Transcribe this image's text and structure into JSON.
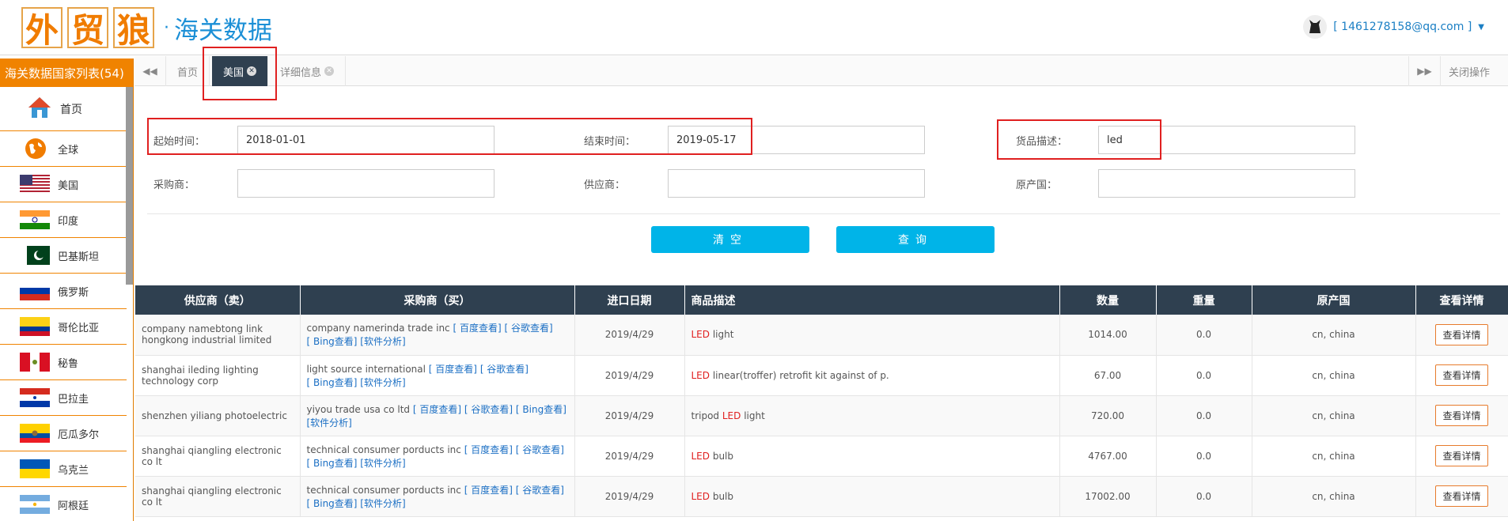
{
  "header": {
    "logo_chars": [
      "外",
      "贸",
      "狼"
    ],
    "logo_dot": "·",
    "logo_sub": "海关数据",
    "user_email": "[ 1461278158@qq.com ]"
  },
  "sidebar": {
    "title": "海关数据国家列表(54)",
    "items": [
      {
        "label": "首页",
        "icon": "home-icon"
      },
      {
        "label": "全球",
        "icon": "globe-icon"
      },
      {
        "label": "美国",
        "icon": "flag-us-icon"
      },
      {
        "label": "印度",
        "icon": "flag-india-icon"
      },
      {
        "label": "巴基斯坦",
        "icon": "flag-pakistan-icon"
      },
      {
        "label": "俄罗斯",
        "icon": "flag-russia-icon"
      },
      {
        "label": "哥伦比亚",
        "icon": "flag-colombia-icon"
      },
      {
        "label": "秘鲁",
        "icon": "flag-peru-icon"
      },
      {
        "label": "巴拉圭",
        "icon": "flag-paraguay-icon"
      },
      {
        "label": "厄瓜多尔",
        "icon": "flag-ecuador-icon"
      },
      {
        "label": "乌克兰",
        "icon": "flag-ukraine-icon"
      },
      {
        "label": "阿根廷",
        "icon": "flag-argentina-icon"
      }
    ]
  },
  "tabs": {
    "prev": "◀◀",
    "items": [
      {
        "label": "首页"
      },
      {
        "label": "美国"
      },
      {
        "label": "详细信息"
      }
    ],
    "next": "▶▶",
    "close_ops": "关闭操作"
  },
  "form": {
    "start_label": "起始时间：",
    "start_value": "2018-01-01",
    "end_label": "结束时间：",
    "end_value": "2019-05-17",
    "goods_label": "货品描述：",
    "goods_value": "led",
    "buyer_label": "采购商：",
    "buyer_value": "",
    "supplier_label": "供应商：",
    "supplier_value": "",
    "origin_label": "原产国：",
    "origin_value": "",
    "clear_button": "清空",
    "query_button": "查询"
  },
  "table": {
    "headers": [
      "供应商（卖）",
      "采购商（买）",
      "进口日期",
      "商品描述",
      "数量",
      "重量",
      "原产国",
      "查看详情"
    ],
    "link_baidu": "[ 百度查看]",
    "link_google": "[ 谷歌查看]",
    "link_bing": "[ Bing查看]",
    "link_soft": "[软件分析]",
    "detail_label": "查看详情",
    "rows": [
      {
        "supplier": "company namebtong link hongkong industrial limited",
        "buyer": "company namerinda trade inc",
        "date": "2019/4/29",
        "desc_hl": "LED",
        "desc": " light",
        "qty": "1014.00",
        "weight": "0.0",
        "origin": "cn, china"
      },
      {
        "supplier": "shanghai ileding lighting technology corp",
        "buyer": "light source international",
        "date": "2019/4/29",
        "desc_hl": "LED",
        "desc": " linear(troffer) retrofit kit against of p.",
        "qty": "67.00",
        "weight": "0.0",
        "origin": "cn, china"
      },
      {
        "supplier": "shenzhen yiliang photoelectric",
        "buyer": "yiyou trade usa co ltd",
        "date": "2019/4/29",
        "desc_pre": "tripod ",
        "desc_hl": "LED",
        "desc": " light",
        "qty": "720.00",
        "weight": "0.0",
        "origin": "cn, china"
      },
      {
        "supplier": "shanghai qiangling electronic co lt",
        "buyer": "technical consumer porducts inc",
        "date": "2019/4/29",
        "desc_hl": "LED",
        "desc": " bulb",
        "qty": "4767.00",
        "weight": "0.0",
        "origin": "cn, china"
      },
      {
        "supplier": "shanghai qiangling electronic co lt",
        "buyer": "technical consumer porducts inc",
        "date": "2019/4/29",
        "desc_hl": "LED",
        "desc": " bulb",
        "qty": "17002.00",
        "weight": "0.0",
        "origin": "cn, china"
      }
    ]
  },
  "colors": {
    "brand_orange": "#f08300",
    "dark_header": "#2f4050",
    "button_blue": "#00b4e8",
    "highlight_red": "#e02020"
  }
}
